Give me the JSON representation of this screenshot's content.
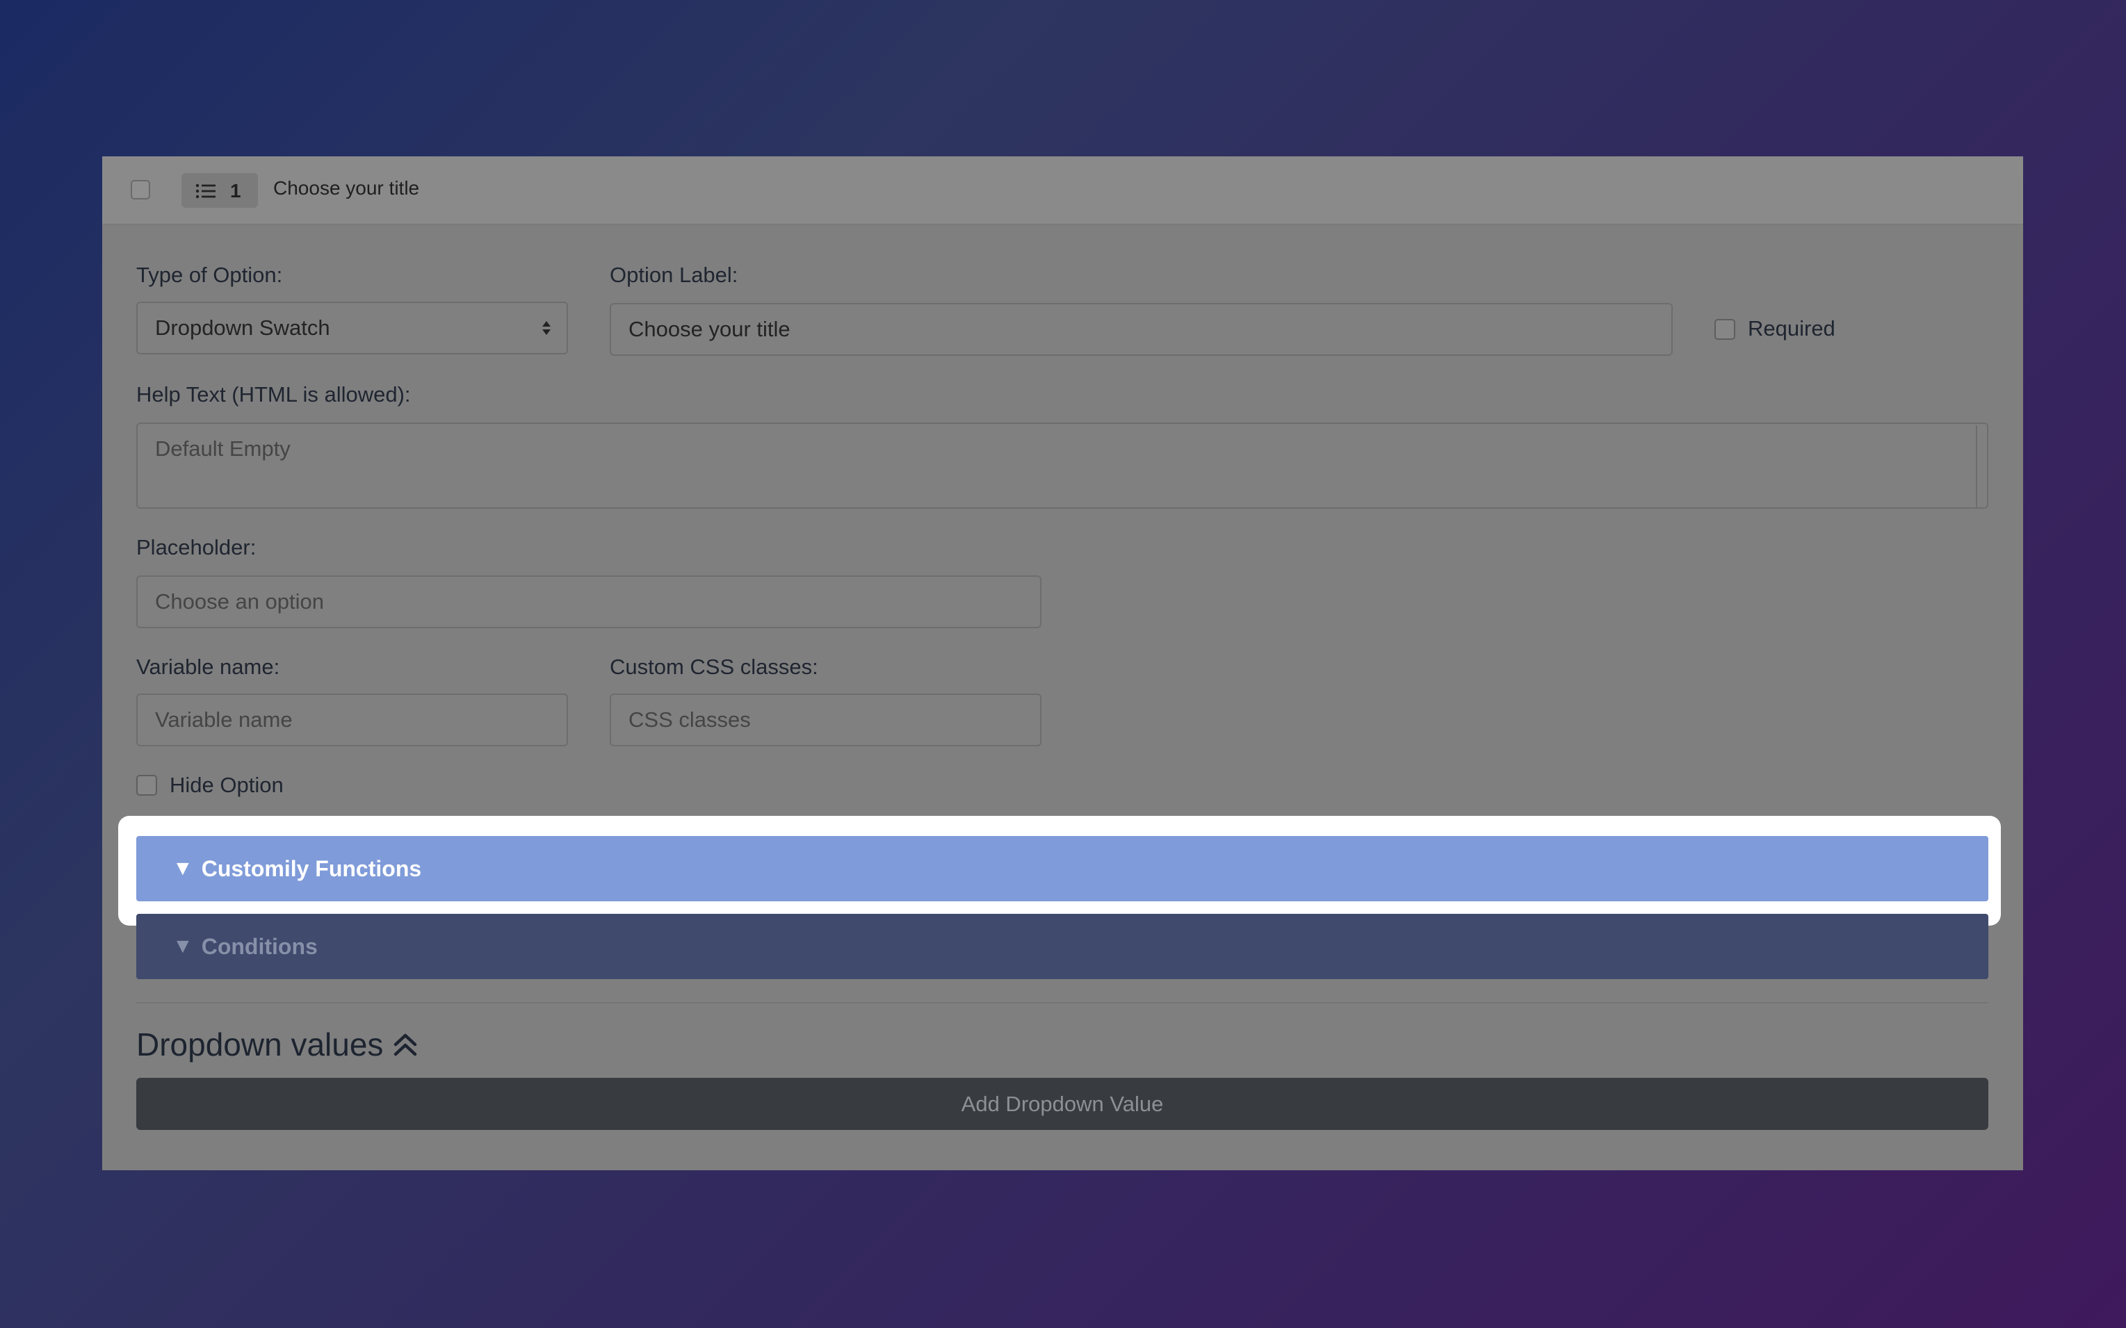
{
  "header": {
    "index": "1",
    "title": "Choose your title"
  },
  "form": {
    "type_label": "Type of Option:",
    "type_value": "Dropdown Swatch",
    "option_label_label": "Option Label:",
    "option_label_value": "Choose your title",
    "required_label": "Required",
    "help_label": "Help Text (HTML is allowed):",
    "help_placeholder": "Default Empty",
    "placeholder_label": "Placeholder:",
    "placeholder_value": "Choose an option",
    "variable_label": "Variable name:",
    "variable_placeholder": "Variable name",
    "css_label": "Custom CSS classes:",
    "css_placeholder": "CSS classes",
    "hide_option_label": "Hide Option"
  },
  "sections": {
    "customily": "Customily Functions",
    "conditions": "Conditions",
    "triangle": "▼"
  },
  "dropdown": {
    "heading": "Dropdown values",
    "add_button": "Add Dropdown Value"
  },
  "colors": {
    "customily_bar": "#7f9bd9",
    "conditions_bar": "#3f4a6d",
    "add_button": "#383b40",
    "highlight": "#ffffff"
  },
  "icons": {
    "badge": "list-icon",
    "select": "select-arrows-icon",
    "heading": "double-chevron-up-icon"
  }
}
